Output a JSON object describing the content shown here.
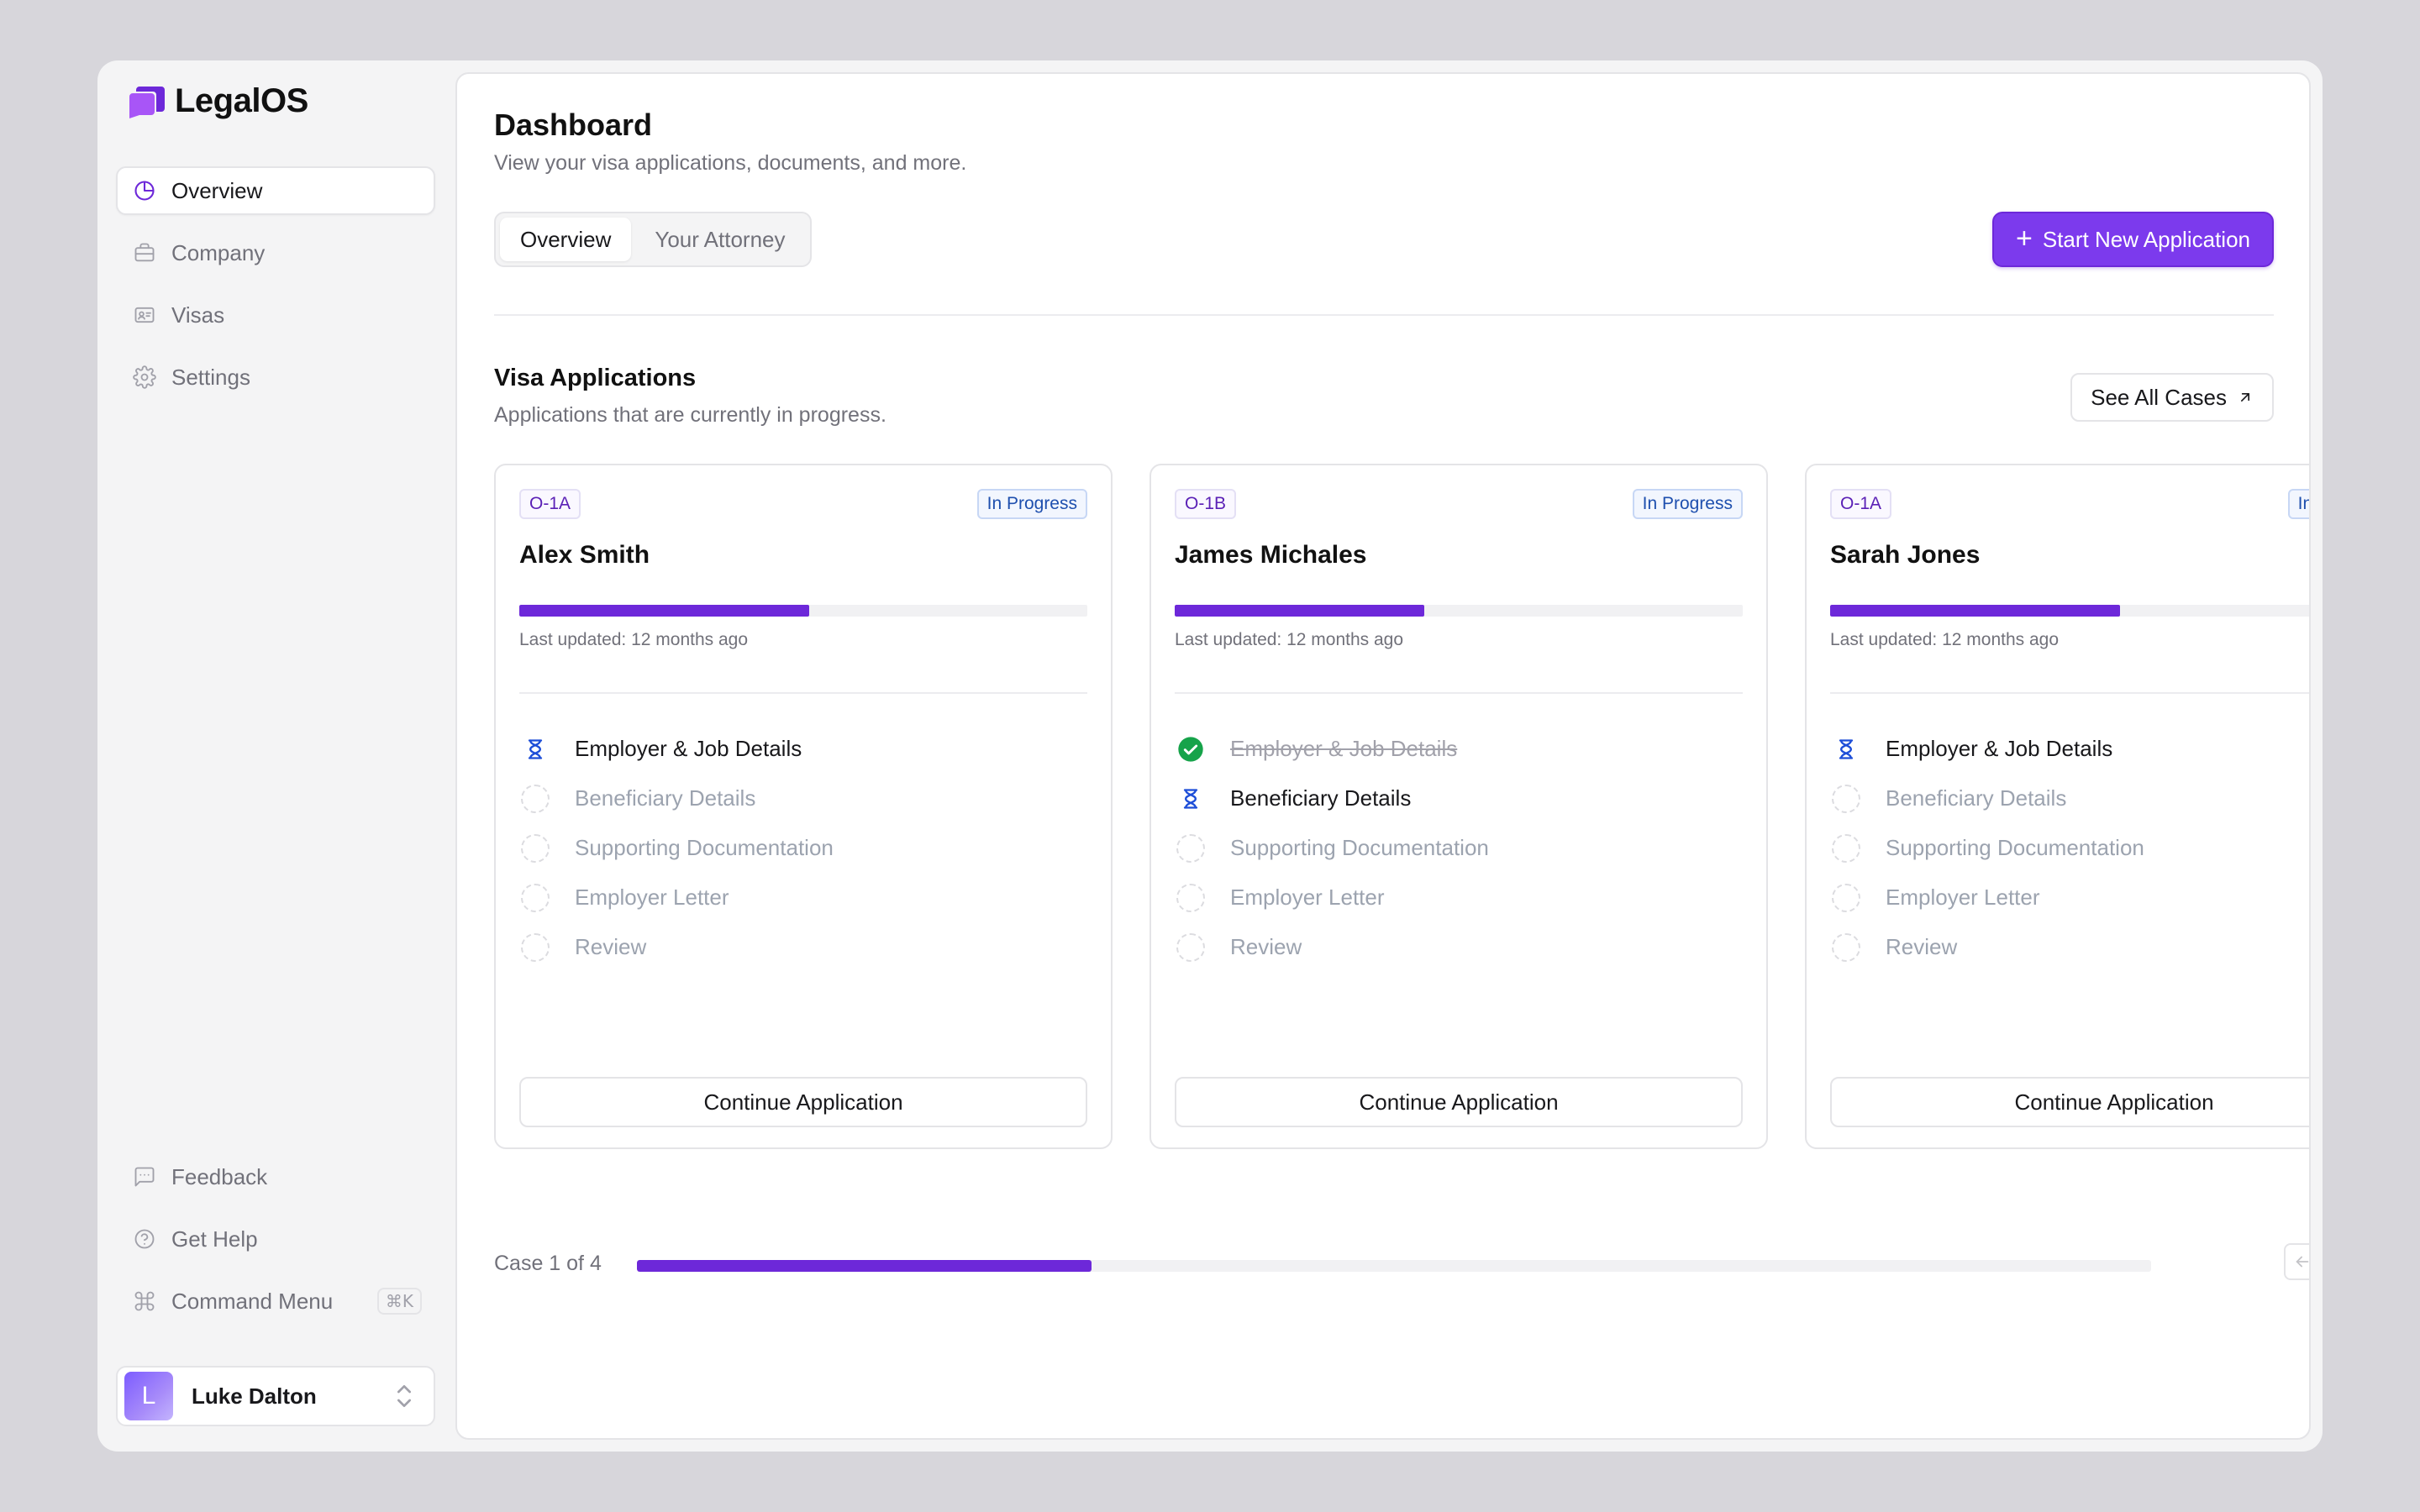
{
  "brand": {
    "name": "LegalOS",
    "accent": "#7c3aed"
  },
  "sidebar": {
    "items": [
      {
        "label": "Overview",
        "icon": "pie-chart-icon",
        "active": true
      },
      {
        "label": "Company",
        "icon": "briefcase-icon",
        "active": false
      },
      {
        "label": "Visas",
        "icon": "id-card-icon",
        "active": false
      },
      {
        "label": "Settings",
        "icon": "gear-icon",
        "active": false
      }
    ],
    "bottom_items": [
      {
        "label": "Feedback",
        "icon": "message-square-icon"
      },
      {
        "label": "Get Help",
        "icon": "help-circle-icon"
      },
      {
        "label": "Command Menu",
        "icon": "command-icon",
        "shortcut": "⌘K"
      }
    ],
    "user": {
      "initial": "L",
      "name": "Luke Dalton"
    }
  },
  "header": {
    "title": "Dashboard",
    "subtitle": "View your visa applications, documents, and more.",
    "tabs": [
      {
        "label": "Overview",
        "active": true
      },
      {
        "label": "Your Attorney",
        "active": false
      }
    ],
    "primary_action": "Start New Application"
  },
  "applications": {
    "title": "Visa Applications",
    "subtitle": "Applications that are currently in progress.",
    "see_all_label": "See All Cases",
    "cards": [
      {
        "visa_type": "O-1A",
        "status": "In Progress",
        "name": "Alex Smith",
        "progress": 0.51,
        "updated": "Last updated: 12 months ago",
        "steps": [
          {
            "label": "Employer & Job Details",
            "state": "active"
          },
          {
            "label": "Beneficiary Details",
            "state": "pending"
          },
          {
            "label": "Supporting Documentation",
            "state": "pending"
          },
          {
            "label": "Employer Letter",
            "state": "pending"
          },
          {
            "label": "Review",
            "state": "pending"
          }
        ],
        "action": "Continue Application"
      },
      {
        "visa_type": "O-1B",
        "status": "In Progress",
        "name": "James Michales",
        "progress": 0.44,
        "updated": "Last updated: 12 months ago",
        "steps": [
          {
            "label": "Employer & Job Details",
            "state": "done"
          },
          {
            "label": "Beneficiary Details",
            "state": "active"
          },
          {
            "label": "Supporting Documentation",
            "state": "pending"
          },
          {
            "label": "Employer Letter",
            "state": "pending"
          },
          {
            "label": "Review",
            "state": "pending"
          }
        ],
        "action": "Continue Application"
      },
      {
        "visa_type": "O-1A",
        "status": "In Progress",
        "name": "Sarah Jones",
        "progress": 0.51,
        "updated": "Last updated: 12 months ago",
        "steps": [
          {
            "label": "Employer & Job Details",
            "state": "active"
          },
          {
            "label": "Beneficiary Details",
            "state": "pending"
          },
          {
            "label": "Supporting Documentation",
            "state": "pending"
          },
          {
            "label": "Employer Letter",
            "state": "pending"
          },
          {
            "label": "Review",
            "state": "pending"
          }
        ],
        "action": "Continue Application"
      }
    ],
    "pager": {
      "label": "Case 1 of 4",
      "progress": 0.3
    }
  },
  "colors": {
    "progress": "#6d28d9",
    "done": "#16a34a",
    "status_text": "#1e4fae"
  }
}
